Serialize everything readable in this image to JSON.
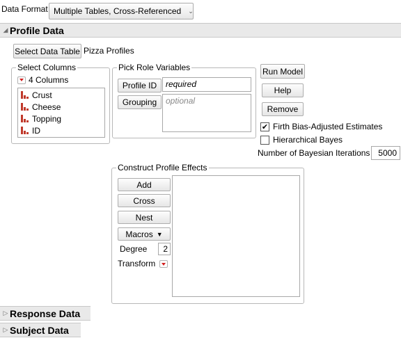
{
  "data_format": {
    "label": "Data Format",
    "selected": "Multiple Tables, Cross-Referenced"
  },
  "profile_section": {
    "title": "Profile Data",
    "select_table_label": "Select Data Table",
    "table_name": "Pizza Profiles"
  },
  "select_columns": {
    "label": "Select Columns",
    "count_label": "4 Columns",
    "columns": [
      "Crust",
      "Cheese",
      "Topping",
      "ID"
    ]
  },
  "pick_roles": {
    "label": "Pick Role Variables",
    "profile_id_label": "Profile ID",
    "profile_id_value": "required",
    "grouping_label": "Grouping",
    "grouping_value": "optional"
  },
  "actions": {
    "run_model": "Run Model",
    "help": "Help",
    "remove": "Remove"
  },
  "options": {
    "firth_label": "Firth Bias-Adjusted Estimates",
    "firth_checked": true,
    "bayes_label": "Hierarchical Bayes",
    "bayes_checked": false,
    "iterations_label": "Number of Bayesian Iterations",
    "iterations_value": "5000"
  },
  "construct_effects": {
    "label": "Construct Profile Effects",
    "add": "Add",
    "cross": "Cross",
    "nest": "Nest",
    "macros": "Macros",
    "degree_label": "Degree",
    "degree_value": "2",
    "transform_label": "Transform"
  },
  "collapsed_sections": {
    "response": "Response Data",
    "subject": "Subject Data"
  }
}
